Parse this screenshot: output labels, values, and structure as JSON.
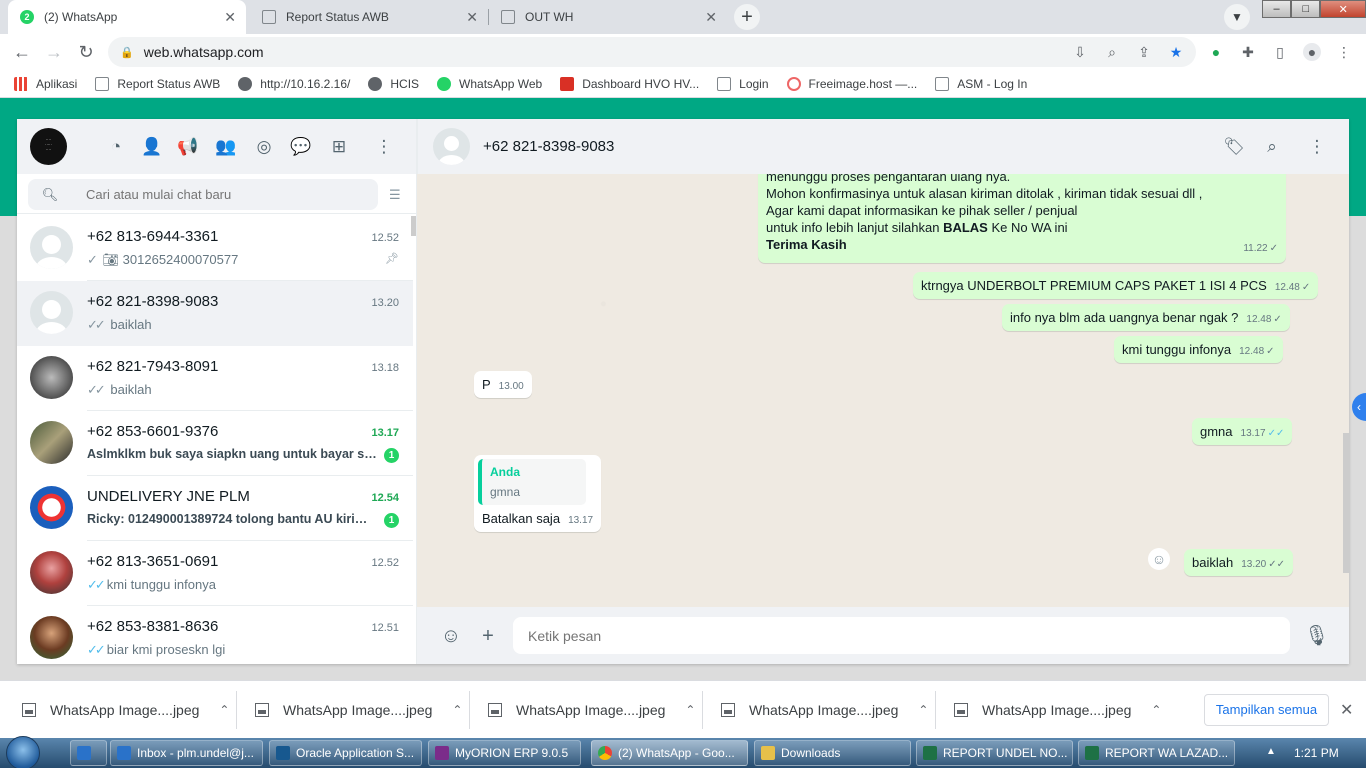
{
  "browser": {
    "tabs": [
      {
        "title": "(2) WhatsApp",
        "favicon": "whatsapp-icon",
        "badge": "2",
        "active": true
      },
      {
        "title": "Report Status AWB",
        "favicon": "page-icon",
        "active": false
      },
      {
        "title": "OUT WH",
        "favicon": "page-icon",
        "active": false
      }
    ],
    "url": "web.whatsapp.com",
    "bookmarks": [
      {
        "label": "Aplikasi",
        "icon": "apps-grid-icon"
      },
      {
        "label": "Report Status AWB",
        "icon": "page-icon"
      },
      {
        "label": "http://10.16.2.16/",
        "icon": "globe-icon"
      },
      {
        "label": "HCIS",
        "icon": "globe-icon"
      },
      {
        "label": "WhatsApp Web",
        "icon": "whatsapp-icon"
      },
      {
        "label": "Dashboard HVO HV...",
        "icon": "dashboard-icon"
      },
      {
        "label": "Login",
        "icon": "page-icon"
      },
      {
        "label": "Freeimage.host —...",
        "icon": "freeimage-icon"
      },
      {
        "label": "ASM - Log In",
        "icon": "page-icon"
      }
    ]
  },
  "whatsapp": {
    "search_placeholder": "Cari atau mulai chat baru",
    "chats": [
      {
        "name": "+62 813-6944-3361",
        "time": "12.52",
        "preview": "3012652400070577",
        "tick": "single",
        "camera": true,
        "pinned": true,
        "avatar": "default"
      },
      {
        "name": "+62 821-8398-9083",
        "time": "13.20",
        "preview": "baiklah",
        "tick": "double-grey",
        "selected": true,
        "avatar": "default"
      },
      {
        "name": "+62 821-7943-8091",
        "time": "13.18",
        "preview": "baiklah",
        "tick": "double-grey",
        "avatar": "photo"
      },
      {
        "name": "+62 853-6601-9376",
        "time": "13.17",
        "preview": "Aslmklkm buk saya siapkn uang untuk bayar sent...",
        "unread": "1",
        "avatar": "photo"
      },
      {
        "name": "UNDELIVERY JNE PLM",
        "time": "12.54",
        "preview": "Ricky: 012490001389724 tolong bantu AU kirima...",
        "unread": "1",
        "avatar": "logo"
      },
      {
        "name": "+62 813-3651-0691",
        "time": "12.52",
        "preview": "kmi tunggu infonya",
        "tick": "double-blue",
        "avatar": "photo"
      },
      {
        "name": "+62 853-8381-8636",
        "time": "12.51",
        "preview": "biar kmi proseskn lgi",
        "tick": "double-blue",
        "avatar": "photo"
      }
    ],
    "conversation": {
      "contact": "+62 821-8398-9083",
      "input_placeholder": "Ketik pesan",
      "messages": [
        {
          "dir": "out",
          "lines": [
            "menunggu proses pengantaran ulang nya.",
            "Mohon konfirmasinya untuk alasan kiriman ditolak , kiriman tidak sesuai dll ,",
            "Agar kami dapat informasikan ke pihak seller / penjual"
          ],
          "line4_pre": "untuk info lebih lanjut silahkan ",
          "line4_bold": "BALAS",
          "line4_post": " Ke No WA ini",
          "line5_bold": "Terima Kasih",
          "time": "11.22",
          "tick": "✓"
        },
        {
          "dir": "out",
          "text": "ktrngya UNDERBOLT PREMIUM CAPS PAKET 1 ISI 4 PCS",
          "time": "12.48",
          "tick": "✓"
        },
        {
          "dir": "out",
          "text": "info nya blm ada uangnya benar ngak ?",
          "time": "12.48",
          "tick": "✓"
        },
        {
          "dir": "out",
          "text": "kmi tunggu infonya",
          "time": "12.48",
          "tick": "✓"
        },
        {
          "dir": "in",
          "text": "P",
          "time": "13.00"
        },
        {
          "dir": "out",
          "text": "gmna",
          "time": "13.17",
          "tick": "✓✓"
        },
        {
          "dir": "in",
          "quote_name": "Anda",
          "quote_text": "gmna",
          "text": "Batalkan saja",
          "time": "13.17"
        },
        {
          "dir": "out",
          "text": "baiklah",
          "time": "13.20",
          "tick": "✓✓"
        }
      ]
    }
  },
  "downloads": {
    "items": [
      "WhatsApp Image....jpeg",
      "WhatsApp Image....jpeg",
      "WhatsApp Image....jpeg",
      "WhatsApp Image....jpeg",
      "WhatsApp Image....jpeg"
    ],
    "show_all": "Tampilkan semua"
  },
  "taskbar": {
    "items": [
      {
        "label": "Inbox - plm.undel@j...",
        "icon": "outlook-icon",
        "color": "#2a72c9"
      },
      {
        "label": "Oracle Application S...",
        "icon": "oracle-icon",
        "color": "#17588f"
      },
      {
        "label": "MyORION ERP 9.0.5",
        "icon": "orion-icon",
        "color": "#7b2c8a"
      },
      {
        "label": "(2) WhatsApp - Goo...",
        "icon": "chrome-icon",
        "color": "#e0a020"
      },
      {
        "label": "Downloads",
        "icon": "folder-icon",
        "color": "#e6c04a"
      },
      {
        "label": "REPORT UNDEL NO...",
        "icon": "excel-icon",
        "color": "#1e7145"
      },
      {
        "label": "REPORT WA LAZAD...",
        "icon": "excel-icon",
        "color": "#1e7145"
      }
    ],
    "clock": "1:21 PM"
  },
  "colors": {
    "wa_green": "#00a884",
    "out_bubble": "#d9fdd3",
    "read_tick": "#53bdeb",
    "unread_badge": "#25d366"
  }
}
